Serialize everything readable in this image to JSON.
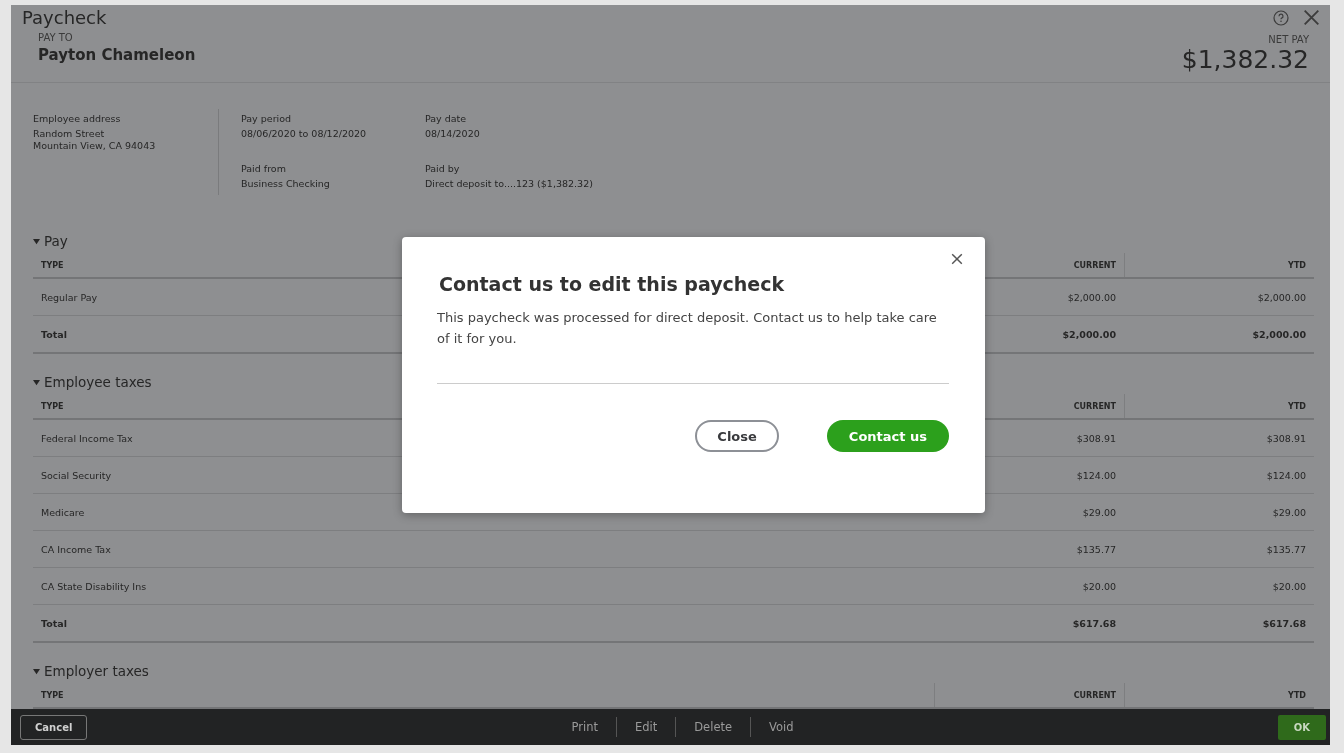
{
  "window": {
    "title": "Paycheck"
  },
  "pay_to": {
    "label": "PAY TO",
    "name": "Payton Chameleon"
  },
  "net_pay": {
    "label": "NET PAY",
    "amount": "$1,382.32"
  },
  "details": [
    {
      "label": "Employee address",
      "lines": [
        "Random Street",
        "Mountain View, CA 94043"
      ]
    },
    {
      "label": "Pay period",
      "lines": [
        "08/06/2020 to 08/12/2020"
      ]
    },
    {
      "label": "Pay date",
      "lines": [
        "08/14/2020"
      ]
    },
    {
      "label": "Paid from",
      "lines": [
        "Business Checking"
      ]
    },
    {
      "label": "Paid by",
      "lines": [
        "Direct deposit to....123 ($1,382.32)"
      ]
    }
  ],
  "sections": [
    {
      "title": "Pay",
      "expanded": true,
      "columns": [
        "TYPE",
        "CURRENT",
        "YTD"
      ],
      "rows": [
        {
          "kind": "item",
          "type": "Regular Pay",
          "current": "$2,000.00",
          "ytd": "$2,000.00"
        },
        {
          "kind": "total",
          "type": "Total",
          "current": "$2,000.00",
          "ytd": "$2,000.00"
        }
      ]
    },
    {
      "title": "Employee taxes",
      "expanded": true,
      "columns": [
        "TYPE",
        "CURRENT",
        "YTD"
      ],
      "rows": [
        {
          "kind": "item",
          "type": "Federal Income Tax",
          "current": "$308.91",
          "ytd": "$308.91"
        },
        {
          "kind": "item",
          "type": "Social Security",
          "current": "$124.00",
          "ytd": "$124.00"
        },
        {
          "kind": "item",
          "type": "Medicare",
          "current": "$29.00",
          "ytd": "$29.00"
        },
        {
          "kind": "item",
          "type": "CA Income Tax",
          "current": "$135.77",
          "ytd": "$135.77"
        },
        {
          "kind": "item",
          "type": "CA State Disability Ins",
          "current": "$20.00",
          "ytd": "$20.00"
        },
        {
          "kind": "total",
          "type": "Total",
          "current": "$617.68",
          "ytd": "$617.68"
        }
      ]
    },
    {
      "title": "Employer taxes",
      "expanded": true,
      "columns": [
        "TYPE",
        "CURRENT",
        "YTD"
      ]
    }
  ],
  "footer": {
    "cancel": "Cancel",
    "actions": [
      "Print",
      "Edit",
      "Delete",
      "Void"
    ],
    "ok": "OK"
  },
  "dialog": {
    "title": "Contact us to edit this paycheck",
    "message": "This paycheck was processed for direct deposit. Contact us to help take care of it for you.",
    "buttons": [
      {
        "kind": "secondary",
        "label": "Close"
      },
      {
        "kind": "primary",
        "label": "Contact us"
      }
    ]
  }
}
